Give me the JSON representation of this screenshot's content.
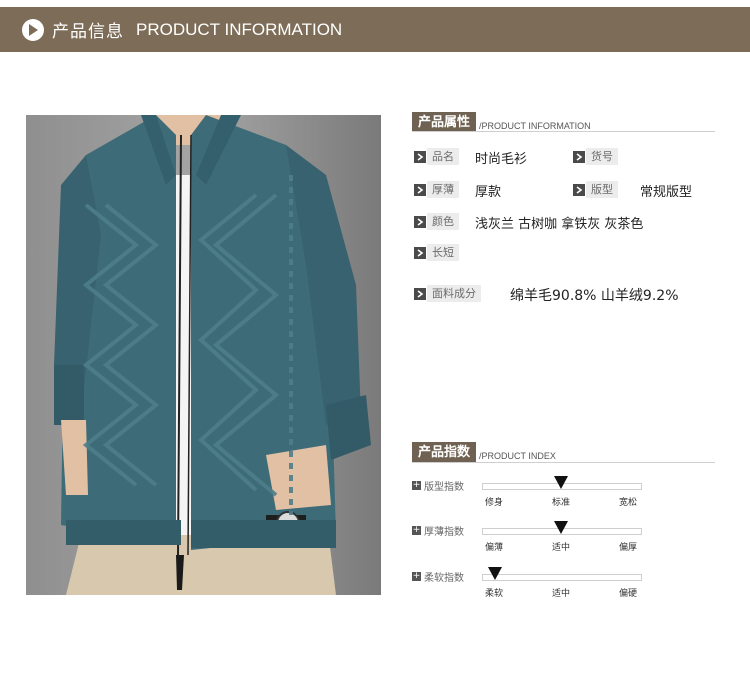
{
  "header": {
    "title_cn": "产品信息",
    "title_en": "PRODUCT INFORMATION"
  },
  "attributes_section": {
    "title_cn": "产品属性",
    "title_en": "/PRODUCT INFORMATION",
    "rows": [
      {
        "label": "品名",
        "value": "时尚毛衫"
      },
      {
        "label": "货号",
        "value": ""
      },
      {
        "label": "厚薄",
        "value": "厚款"
      },
      {
        "label": "版型",
        "value": "常规版型"
      },
      {
        "label": "颜色",
        "value": "浅灰兰 古树咖 拿铁灰 灰茶色"
      },
      {
        "label": "长短",
        "value": ""
      },
      {
        "label": "面料成分",
        "value": "绵羊毛90.8%  山羊绒9.2%"
      }
    ]
  },
  "index_section": {
    "title_cn": "产品指数",
    "title_en": "/PRODUCT INDEX",
    "indices": [
      {
        "label": "版型指数",
        "ticks": [
          "修身",
          "标准",
          "宽松"
        ],
        "level": 0.5
      },
      {
        "label": "厚薄指数",
        "ticks": [
          "偏薄",
          "适中",
          "偏厚"
        ],
        "level": 0.5
      },
      {
        "label": "柔软指数",
        "ticks": [
          "柔软",
          "适中",
          "偏硬"
        ],
        "level": 0.08
      }
    ]
  },
  "colors": {
    "header_bg": "#7d6d58",
    "tag_bg": "#6f6252",
    "sweater": "#3e6b78",
    "photo_bg": "#9c9c9c"
  }
}
